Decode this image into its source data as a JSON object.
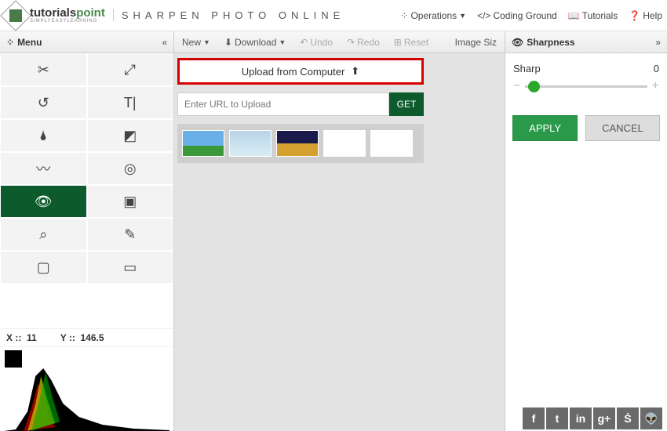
{
  "header": {
    "brand_main": "tutorials",
    "brand_accent": "point",
    "brand_sub": "SIMPLYEASYLEARNING",
    "page_title": "SHARPEN PHOTO ONLINE",
    "nav": {
      "operations": "Operations",
      "coding": "Coding Ground",
      "tutorials": "Tutorials",
      "help": "Help"
    }
  },
  "subbar": {
    "menu": "Menu",
    "new": "New",
    "download": "Download",
    "undo": "Undo",
    "redo": "Redo",
    "reset": "Reset",
    "image_size": "Image Siz",
    "sharpness": "Sharpness"
  },
  "upload": {
    "button": "Upload from Computer",
    "placeholder": "Enter URL to Upload",
    "get": "GET"
  },
  "panel": {
    "param_label": "Sharp",
    "param_value": "0",
    "apply": "APPLY",
    "cancel": "CANCEL"
  },
  "status": {
    "x_label": "X ::",
    "x_val": "11",
    "y_label": "Y ::",
    "y_val": "146.5"
  },
  "tools": [
    {
      "name": "crop-icon",
      "glyph": "✂"
    },
    {
      "name": "fullscreen-icon",
      "glyph": "⤢"
    },
    {
      "name": "rotate-icon",
      "glyph": "↺"
    },
    {
      "name": "text-icon",
      "glyph": "T|"
    },
    {
      "name": "drop-icon",
      "glyph": "🌢"
    },
    {
      "name": "levels-icon",
      "glyph": "◩"
    },
    {
      "name": "wave-icon",
      "glyph": "〰"
    },
    {
      "name": "target-icon",
      "glyph": "◎"
    },
    {
      "name": "eye-icon",
      "glyph": "👁"
    },
    {
      "name": "image-icon",
      "glyph": "▣"
    },
    {
      "name": "search-icon",
      "glyph": "⌕"
    },
    {
      "name": "brush-icon",
      "glyph": "✎"
    },
    {
      "name": "bounds-icon",
      "glyph": "▢"
    },
    {
      "name": "frame-icon",
      "glyph": "▭"
    }
  ],
  "social": [
    {
      "name": "facebook-icon",
      "glyph": "f"
    },
    {
      "name": "twitter-icon",
      "glyph": "t"
    },
    {
      "name": "linkedin-icon",
      "glyph": "in"
    },
    {
      "name": "gplus-icon",
      "glyph": "g+"
    },
    {
      "name": "stumble-icon",
      "glyph": "Ṡ"
    },
    {
      "name": "reddit-icon",
      "glyph": "👽"
    }
  ]
}
